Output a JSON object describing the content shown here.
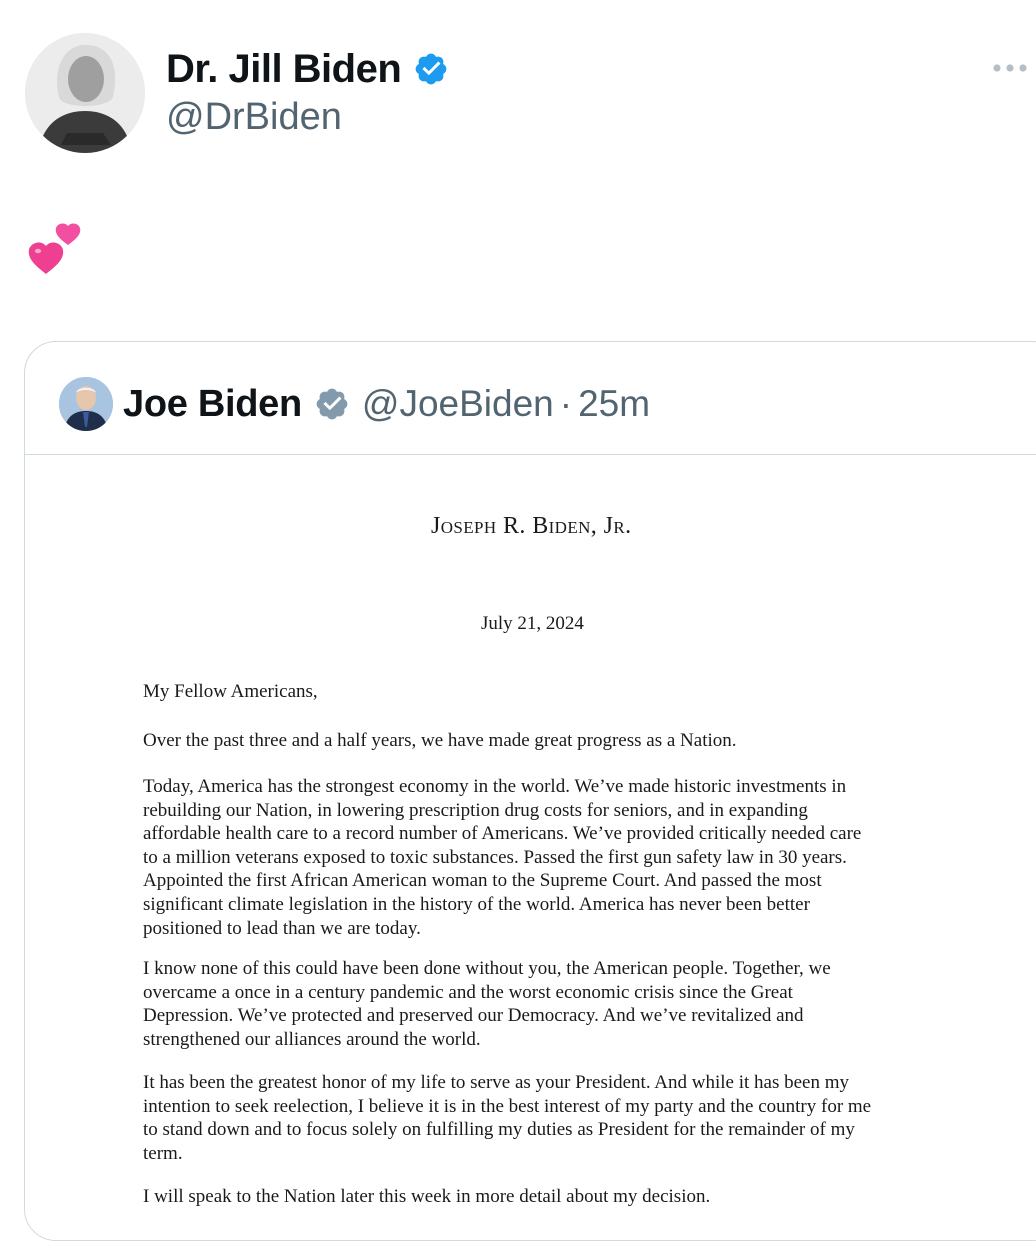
{
  "post": {
    "author_name": "Dr. Jill Biden",
    "author_handle": "@DrBiden",
    "verified_icon": "verified-badge-icon",
    "verified_color": "#1d9bf0",
    "more_icon": "more-options-icon",
    "text": "💕"
  },
  "quote": {
    "author_name": "Joe Biden",
    "author_handle": "@JoeBiden",
    "separator": "·",
    "time": "25m",
    "verified_icon": "government-verified-badge-icon",
    "verified_color": "#829aab"
  },
  "letter": {
    "letterhead": "Joseph R. Biden, Jr.",
    "date": "July 21, 2024",
    "salutation": "My Fellow Americans,",
    "paragraphs": [
      [
        "Over the past three and a half years, we have made great progress as a Nation."
      ],
      [
        "Today, America has the strongest economy in the world. We’ve made historic investments in",
        "rebuilding our Nation, in lowering prescription drug costs for seniors, and in expanding",
        "affordable health care to a record number of Americans. We’ve provided critically needed care",
        "to a million veterans exposed to toxic substances. Passed the first gun safety law in 30 years.",
        "Appointed the first African American woman to the Supreme Court. And passed the most",
        "significant climate legislation in the history of the world. America has never been better",
        "positioned to lead than we are today."
      ],
      [
        "I know none of this could have been done without you, the American people. Together, we",
        "overcame a once in a century pandemic and the worst economic crisis since the Great",
        "Depression. We’ve protected and preserved our Democracy. And we’ve revitalized and",
        "strengthened our alliances around the world."
      ],
      [
        "It has been the greatest honor of my life to serve as your President. And while it has been my",
        "intention to seek reelection, I believe it is in the best interest of my party and the country for me",
        "to stand down and to focus solely on fulfilling my duties as President for the remainder of my",
        "term."
      ],
      [
        "I will speak to the Nation later this week in more detail about my decision."
      ]
    ]
  }
}
